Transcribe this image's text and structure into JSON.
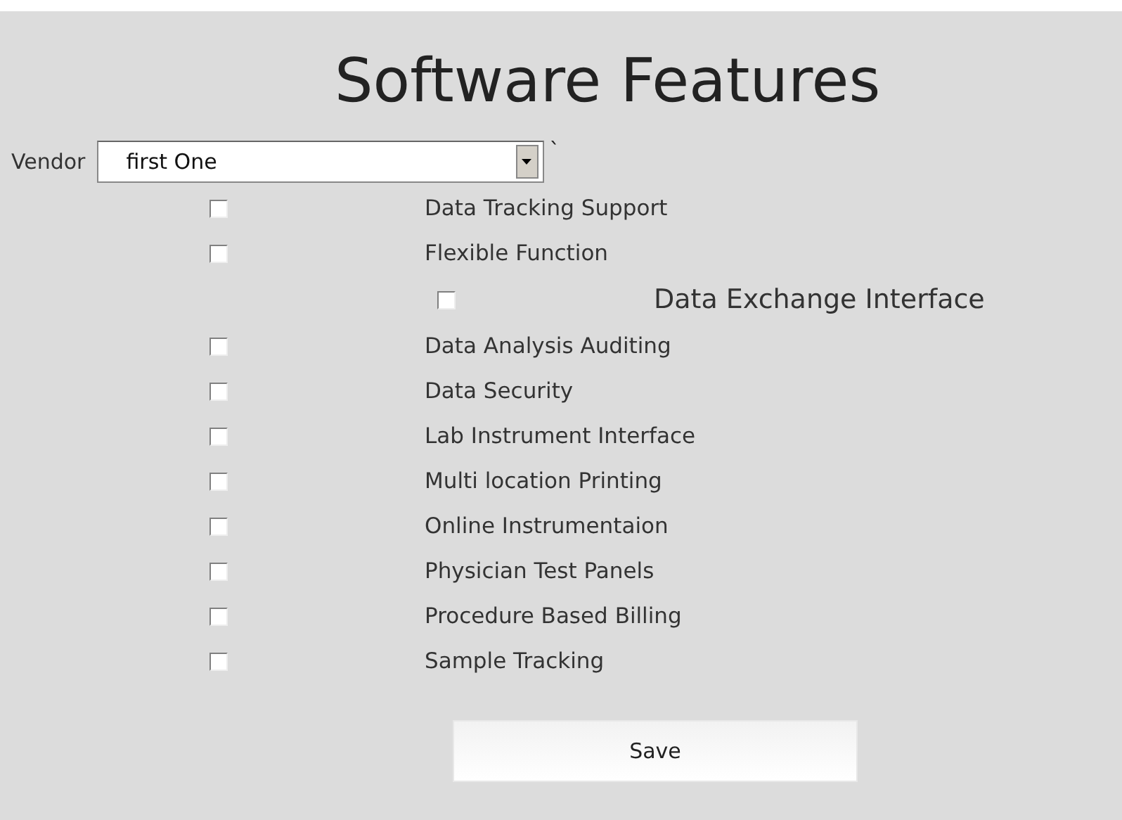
{
  "title": "Software Features",
  "vendor": {
    "label": "Vendor",
    "value": "first One",
    "trailing_mark": "`"
  },
  "features": [
    {
      "label": "Data Tracking Support",
      "checked": false,
      "kind": "normal"
    },
    {
      "label": "Flexible Function",
      "checked": false,
      "kind": "normal"
    },
    {
      "label": "Data Exchange Interface",
      "checked": false,
      "kind": "indented"
    },
    {
      "label": "Data Analysis Auditing",
      "checked": false,
      "kind": "normal"
    },
    {
      "label": "Data Security",
      "checked": false,
      "kind": "normal"
    },
    {
      "label": "Lab Instrument Interface",
      "checked": false,
      "kind": "normal"
    },
    {
      "label": "Multi location Printing",
      "checked": false,
      "kind": "normal"
    },
    {
      "label": "Online Instrumentaion",
      "checked": false,
      "kind": "normal"
    },
    {
      "label": "Physician Test Panels",
      "checked": false,
      "kind": "normal"
    },
    {
      "label": "Procedure Based Billing",
      "checked": false,
      "kind": "normal"
    },
    {
      "label": "Sample Tracking",
      "checked": false,
      "kind": "normal"
    }
  ],
  "save_button": "Save"
}
